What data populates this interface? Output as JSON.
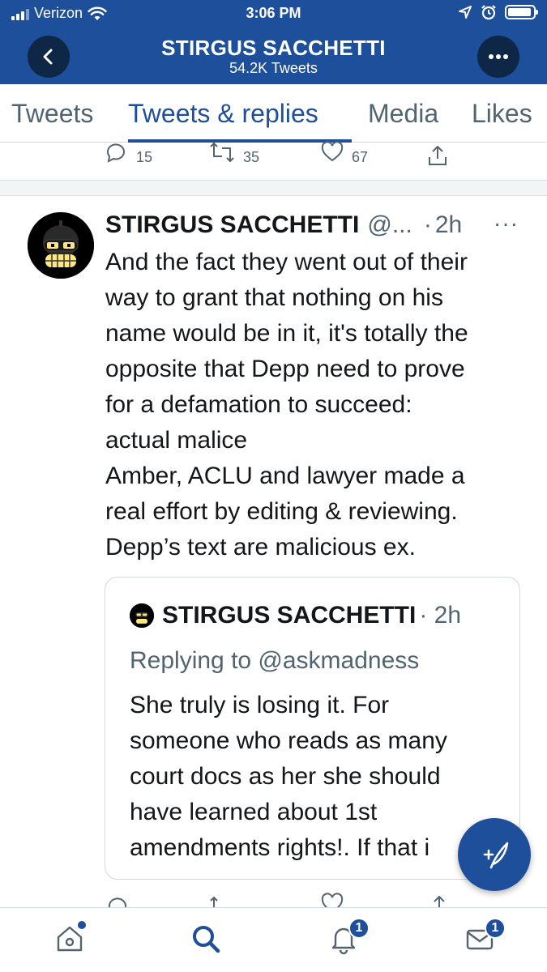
{
  "status_bar": {
    "carrier": "Verizon",
    "time": "3:06 PM"
  },
  "header": {
    "title": "STIRGUS SACCHETTI",
    "subtitle": "54.2K Tweets"
  },
  "tabs": [
    {
      "label": "Tweets"
    },
    {
      "label": "Tweets & replies"
    },
    {
      "label": "Media"
    },
    {
      "label": "Likes"
    }
  ],
  "active_tab": "Tweets & replies",
  "previous_tweet_actions": {
    "replies": "15",
    "retweets": "35",
    "likes": "67"
  },
  "tweet": {
    "name": "STIRGUS SACCHETTI",
    "handle": "@...",
    "dot": "·",
    "time": "2h",
    "menu": "···",
    "lines": [
      "And the fact they went out of their",
      "way to grant that nothing on his",
      "name would be in it, it's totally the",
      "opposite that Depp need to prove",
      "for a defamation to succeed:",
      "actual malice",
      "Amber, ACLU and lawyer made a",
      "real effort by editing & reviewing.",
      "Depp’s text are malicious ex."
    ]
  },
  "quoted_tweet": {
    "name": "STIRGUS SACCHETTI",
    "time": "· 2h",
    "replying_to": "Replying to @askmadness",
    "lines": [
      "She truly is losing it. For",
      "someone who reads as many",
      "court docs as her she should",
      "have learned about 1st",
      "amendments rights!. If that i"
    ]
  },
  "bottom_nav": {
    "notifications_badge": "1",
    "messages_badge": "1"
  },
  "colors": {
    "brand": "#1d4f9a",
    "header_button": "#0f2747",
    "muted": "#536471"
  }
}
